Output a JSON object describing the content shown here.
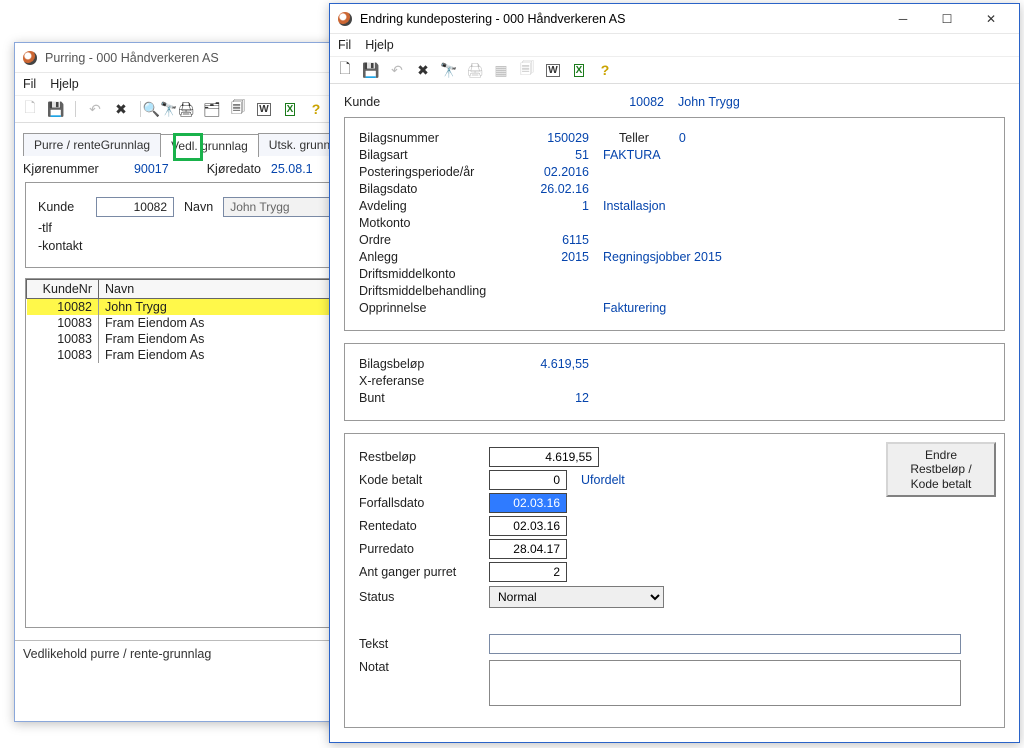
{
  "left_window": {
    "title": "Purring - 000 Håndverkeren AS",
    "menu": {
      "fil": "Fil",
      "hjelp": "Hjelp"
    },
    "tabs": {
      "t1": "Purre / renteGrunnlag",
      "t2": "Vedl. grunnlag",
      "t3": "Utsk. grunnlag"
    },
    "run_no_label": "Kjørenummer",
    "run_no": "90017",
    "run_date_label": "Kjøredato",
    "run_date": "25.08.1",
    "kunde_label": "Kunde",
    "kunde_value": "10082",
    "navn_label": "Navn",
    "navn_value": "John Trygg",
    "tlf_label": "-tlf",
    "kontakt_label": "-kontakt",
    "cols": {
      "c0": "KundeNr",
      "c1": "Navn"
    },
    "rows": [
      {
        "nr": "10082",
        "navn": "John Trygg"
      },
      {
        "nr": "10083",
        "navn": "Fram Eiendom As"
      },
      {
        "nr": "10083",
        "navn": "Fram Eiendom As"
      },
      {
        "nr": "10083",
        "navn": "Fram Eiendom As"
      }
    ],
    "status": "Vedlikehold purre / rente-grunnlag"
  },
  "right_window": {
    "title": "Endring kundepostering - 000 Håndverkeren AS",
    "menu": {
      "fil": "Fil",
      "hjelp": "Hjelp"
    },
    "kunde_label": "Kunde",
    "kunde_no": "10082",
    "kunde_name": "John Trygg",
    "fields": {
      "bilagsnummer_l": "Bilagsnummer",
      "bilagsnummer_v": "150029",
      "teller_l": "Teller",
      "teller_v": "0",
      "bilagsart_l": "Bilagsart",
      "bilagsart_v": "51",
      "bilagsart_t": "FAKTURA",
      "periode_l": "Posteringsperiode/år",
      "periode_v": "02.2016",
      "bilagsdato_l": "Bilagsdato",
      "bilagsdato_v": "26.02.16",
      "avdeling_l": "Avdeling",
      "avdeling_v": "1",
      "avdeling_t": "Installasjon",
      "motkonto_l": "Motkonto",
      "ordre_l": "Ordre",
      "ordre_v": "6115",
      "anlegg_l": "Anlegg",
      "anlegg_v": "2015",
      "anlegg_t": "Regningsjobber 2015",
      "driftskonto_l": "Driftsmiddelkonto",
      "driftsbeh_l": "Driftsmiddelbehandling",
      "opprinnelse_l": "Opprinnelse",
      "opprinnelse_t": "Fakturering"
    },
    "amount_block": {
      "bilagsbelop_l": "Bilagsbeløp",
      "bilagsbelop_v": "4.619,55",
      "xref_l": "X-referanse",
      "bunt_l": "Bunt",
      "bunt_v": "12"
    },
    "edit_block": {
      "restbelop_l": "Restbeløp",
      "restbelop_v": "4.619,55",
      "kodebetalt_l": "Kode betalt",
      "kodebetalt_v": "0",
      "kodebetalt_t": "Ufordelt",
      "forfall_l": "Forfallsdato",
      "forfall_v": "02.03.16",
      "rentedato_l": "Rentedato",
      "rentedato_v": "02.03.16",
      "purredato_l": "Purredato",
      "purredato_v": "28.04.17",
      "antpurret_l": "Ant ganger purret",
      "antpurret_v": "2",
      "status_l": "Status",
      "status_v": "Normal",
      "tekst_l": "Tekst",
      "notat_l": "Notat",
      "button_line1": "Endre Restbeløp /",
      "button_line2": "Kode betalt"
    }
  }
}
